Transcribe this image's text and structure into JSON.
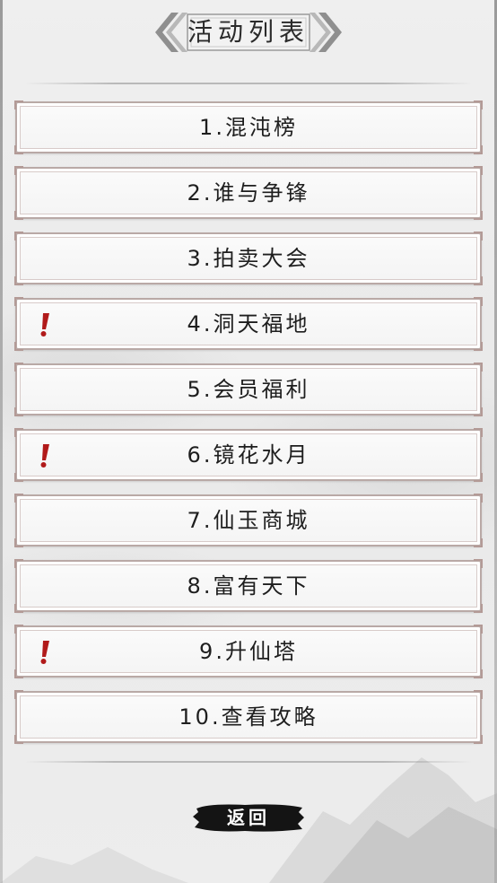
{
  "header": {
    "title": "活动列表"
  },
  "activities": [
    {
      "label": "1.混沌榜",
      "alert": false
    },
    {
      "label": "2.谁与争锋",
      "alert": false
    },
    {
      "label": "3.拍卖大会",
      "alert": false
    },
    {
      "label": "4.洞天福地",
      "alert": true
    },
    {
      "label": "5.会员福利",
      "alert": false
    },
    {
      "label": "6.镜花水月",
      "alert": true
    },
    {
      "label": "7.仙玉商城",
      "alert": false
    },
    {
      "label": "8.富有天下",
      "alert": false
    },
    {
      "label": "9.升仙塔",
      "alert": true
    },
    {
      "label": "10.查看攻略",
      "alert": false
    }
  ],
  "footer": {
    "back_label": "返回"
  },
  "icons": {
    "alert": "exclamation-icon",
    "title_left": "double-chevron-left-icon",
    "title_right": "double-chevron-right-icon"
  },
  "colors": {
    "alert": "#b11a1a",
    "item_border": "#b9a9a6",
    "back_button": "#111111",
    "title_ornament": "#8a8a8a"
  }
}
